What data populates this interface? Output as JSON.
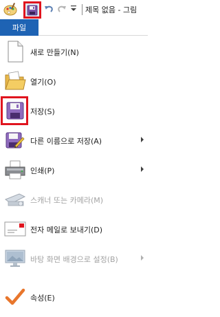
{
  "qat": {
    "app_icon": "paint-palette-icon",
    "save_icon": "floppy-disk-icon",
    "undo_icon": "undo-icon",
    "redo_icon": "redo-icon",
    "customize_icon": "chevron-down-icon",
    "title": "제목 없음 - 그림"
  },
  "file_tab": {
    "label": "파일"
  },
  "menu": {
    "items": [
      {
        "label": "새로 만들기(N)",
        "icon": "new-document-icon",
        "submenu": false,
        "enabled": true
      },
      {
        "label": "열기(O)",
        "icon": "open-folder-icon",
        "submenu": false,
        "enabled": true
      },
      {
        "label": "저장(S)",
        "icon": "floppy-disk-icon",
        "submenu": false,
        "enabled": true
      },
      {
        "label": "다른 이름으로 저장(A)",
        "icon": "save-as-icon",
        "submenu": true,
        "enabled": true
      },
      {
        "label": "인쇄(P)",
        "icon": "printer-icon",
        "submenu": true,
        "enabled": true
      },
      {
        "label": "스캐너 또는 카메라(M)",
        "icon": "scanner-camera-icon",
        "submenu": false,
        "enabled": false
      },
      {
        "label": "전자 메일로 보내기(D)",
        "icon": "email-icon",
        "submenu": false,
        "enabled": true
      },
      {
        "label": "바탕 화면 배경으로 설정(B)",
        "icon": "desktop-background-icon",
        "submenu": true,
        "enabled": false
      },
      {
        "label": "속성(E)",
        "icon": "checkmark-icon",
        "submenu": false,
        "enabled": true
      }
    ]
  },
  "colors": {
    "file_tab": "#1e63b4",
    "highlight": "#e0141e",
    "disabled_text": "#a3a3a3"
  }
}
